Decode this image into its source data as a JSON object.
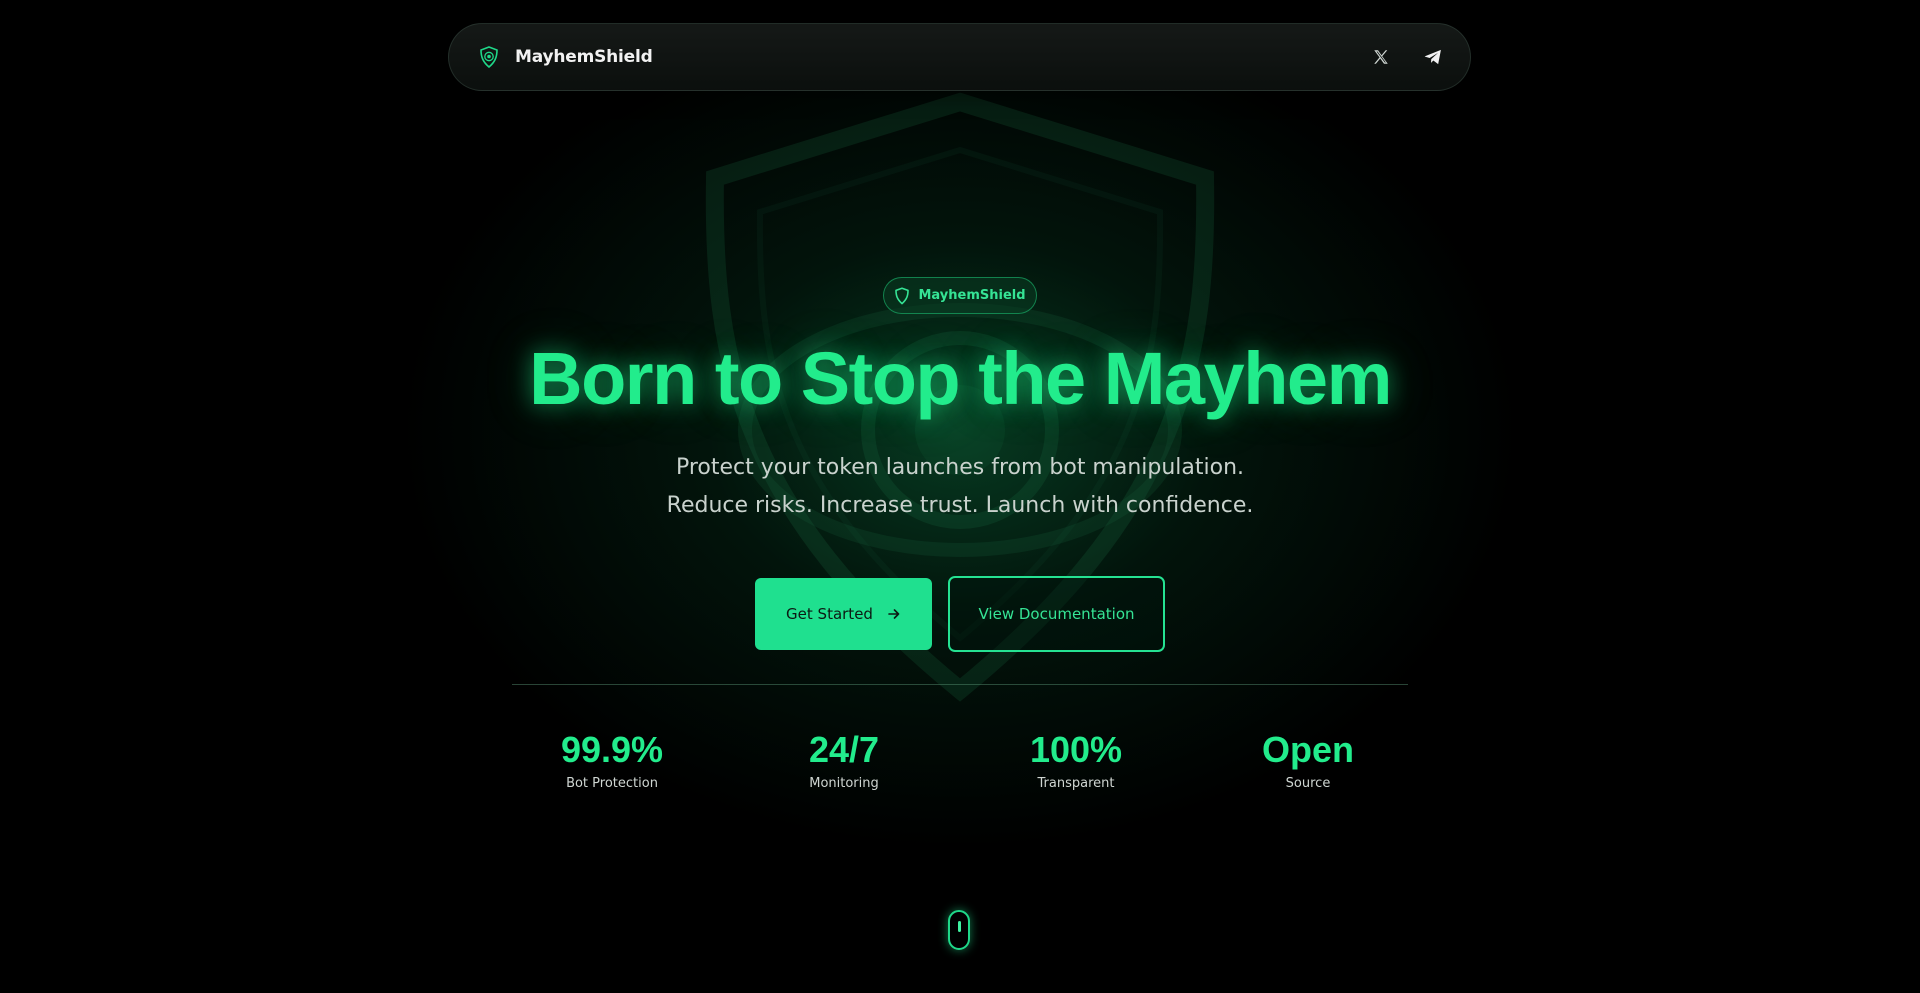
{
  "navbar": {
    "brand_name": "MayhemShield",
    "brand_icon": "shield-logo-icon",
    "social": [
      {
        "name": "x-twitter-icon"
      },
      {
        "name": "telegram-icon"
      }
    ]
  },
  "hero": {
    "badge_icon": "shield-outline-icon",
    "badge_text": "MayhemShield",
    "title": "Born to Stop the Mayhem",
    "subtitle": "Protect your token launches from bot manipulation. Reduce risks. Increase trust. Launch with confidence.",
    "primary_button": "Get Started",
    "primary_button_icon": "arrow-right-icon",
    "secondary_button": "View Documentation"
  },
  "stats": [
    {
      "value": "99.9%",
      "label": "Bot Protection"
    },
    {
      "value": "24/7",
      "label": "Monitoring"
    },
    {
      "value": "100%",
      "label": "Transparent"
    },
    {
      "value": "Open",
      "label": "Source"
    }
  ],
  "colors": {
    "accent": "#22ec8c",
    "button": "#1fe08f",
    "background": "#000000"
  }
}
